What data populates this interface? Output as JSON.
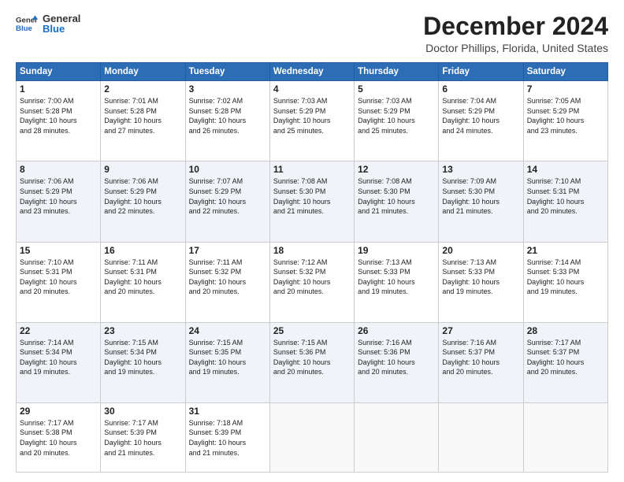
{
  "logo": {
    "line1": "General",
    "line2": "Blue"
  },
  "title": "December 2024",
  "subtitle": "Doctor Phillips, Florida, United States",
  "days_header": [
    "Sunday",
    "Monday",
    "Tuesday",
    "Wednesday",
    "Thursday",
    "Friday",
    "Saturday"
  ],
  "weeks": [
    [
      {
        "day": "1",
        "info": "Sunrise: 7:00 AM\nSunset: 5:28 PM\nDaylight: 10 hours\nand 28 minutes."
      },
      {
        "day": "2",
        "info": "Sunrise: 7:01 AM\nSunset: 5:28 PM\nDaylight: 10 hours\nand 27 minutes."
      },
      {
        "day": "3",
        "info": "Sunrise: 7:02 AM\nSunset: 5:28 PM\nDaylight: 10 hours\nand 26 minutes."
      },
      {
        "day": "4",
        "info": "Sunrise: 7:03 AM\nSunset: 5:29 PM\nDaylight: 10 hours\nand 25 minutes."
      },
      {
        "day": "5",
        "info": "Sunrise: 7:03 AM\nSunset: 5:29 PM\nDaylight: 10 hours\nand 25 minutes."
      },
      {
        "day": "6",
        "info": "Sunrise: 7:04 AM\nSunset: 5:29 PM\nDaylight: 10 hours\nand 24 minutes."
      },
      {
        "day": "7",
        "info": "Sunrise: 7:05 AM\nSunset: 5:29 PM\nDaylight: 10 hours\nand 23 minutes."
      }
    ],
    [
      {
        "day": "8",
        "info": "Sunrise: 7:06 AM\nSunset: 5:29 PM\nDaylight: 10 hours\nand 23 minutes."
      },
      {
        "day": "9",
        "info": "Sunrise: 7:06 AM\nSunset: 5:29 PM\nDaylight: 10 hours\nand 22 minutes."
      },
      {
        "day": "10",
        "info": "Sunrise: 7:07 AM\nSunset: 5:29 PM\nDaylight: 10 hours\nand 22 minutes."
      },
      {
        "day": "11",
        "info": "Sunrise: 7:08 AM\nSunset: 5:30 PM\nDaylight: 10 hours\nand 21 minutes."
      },
      {
        "day": "12",
        "info": "Sunrise: 7:08 AM\nSunset: 5:30 PM\nDaylight: 10 hours\nand 21 minutes."
      },
      {
        "day": "13",
        "info": "Sunrise: 7:09 AM\nSunset: 5:30 PM\nDaylight: 10 hours\nand 21 minutes."
      },
      {
        "day": "14",
        "info": "Sunrise: 7:10 AM\nSunset: 5:31 PM\nDaylight: 10 hours\nand 20 minutes."
      }
    ],
    [
      {
        "day": "15",
        "info": "Sunrise: 7:10 AM\nSunset: 5:31 PM\nDaylight: 10 hours\nand 20 minutes."
      },
      {
        "day": "16",
        "info": "Sunrise: 7:11 AM\nSunset: 5:31 PM\nDaylight: 10 hours\nand 20 minutes."
      },
      {
        "day": "17",
        "info": "Sunrise: 7:11 AM\nSunset: 5:32 PM\nDaylight: 10 hours\nand 20 minutes."
      },
      {
        "day": "18",
        "info": "Sunrise: 7:12 AM\nSunset: 5:32 PM\nDaylight: 10 hours\nand 20 minutes."
      },
      {
        "day": "19",
        "info": "Sunrise: 7:13 AM\nSunset: 5:33 PM\nDaylight: 10 hours\nand 19 minutes."
      },
      {
        "day": "20",
        "info": "Sunrise: 7:13 AM\nSunset: 5:33 PM\nDaylight: 10 hours\nand 19 minutes."
      },
      {
        "day": "21",
        "info": "Sunrise: 7:14 AM\nSunset: 5:33 PM\nDaylight: 10 hours\nand 19 minutes."
      }
    ],
    [
      {
        "day": "22",
        "info": "Sunrise: 7:14 AM\nSunset: 5:34 PM\nDaylight: 10 hours\nand 19 minutes."
      },
      {
        "day": "23",
        "info": "Sunrise: 7:15 AM\nSunset: 5:34 PM\nDaylight: 10 hours\nand 19 minutes."
      },
      {
        "day": "24",
        "info": "Sunrise: 7:15 AM\nSunset: 5:35 PM\nDaylight: 10 hours\nand 19 minutes."
      },
      {
        "day": "25",
        "info": "Sunrise: 7:15 AM\nSunset: 5:36 PM\nDaylight: 10 hours\nand 20 minutes."
      },
      {
        "day": "26",
        "info": "Sunrise: 7:16 AM\nSunset: 5:36 PM\nDaylight: 10 hours\nand 20 minutes."
      },
      {
        "day": "27",
        "info": "Sunrise: 7:16 AM\nSunset: 5:37 PM\nDaylight: 10 hours\nand 20 minutes."
      },
      {
        "day": "28",
        "info": "Sunrise: 7:17 AM\nSunset: 5:37 PM\nDaylight: 10 hours\nand 20 minutes."
      }
    ],
    [
      {
        "day": "29",
        "info": "Sunrise: 7:17 AM\nSunset: 5:38 PM\nDaylight: 10 hours\nand 20 minutes."
      },
      {
        "day": "30",
        "info": "Sunrise: 7:17 AM\nSunset: 5:39 PM\nDaylight: 10 hours\nand 21 minutes."
      },
      {
        "day": "31",
        "info": "Sunrise: 7:18 AM\nSunset: 5:39 PM\nDaylight: 10 hours\nand 21 minutes."
      },
      {
        "day": "",
        "info": ""
      },
      {
        "day": "",
        "info": ""
      },
      {
        "day": "",
        "info": ""
      },
      {
        "day": "",
        "info": ""
      }
    ]
  ]
}
